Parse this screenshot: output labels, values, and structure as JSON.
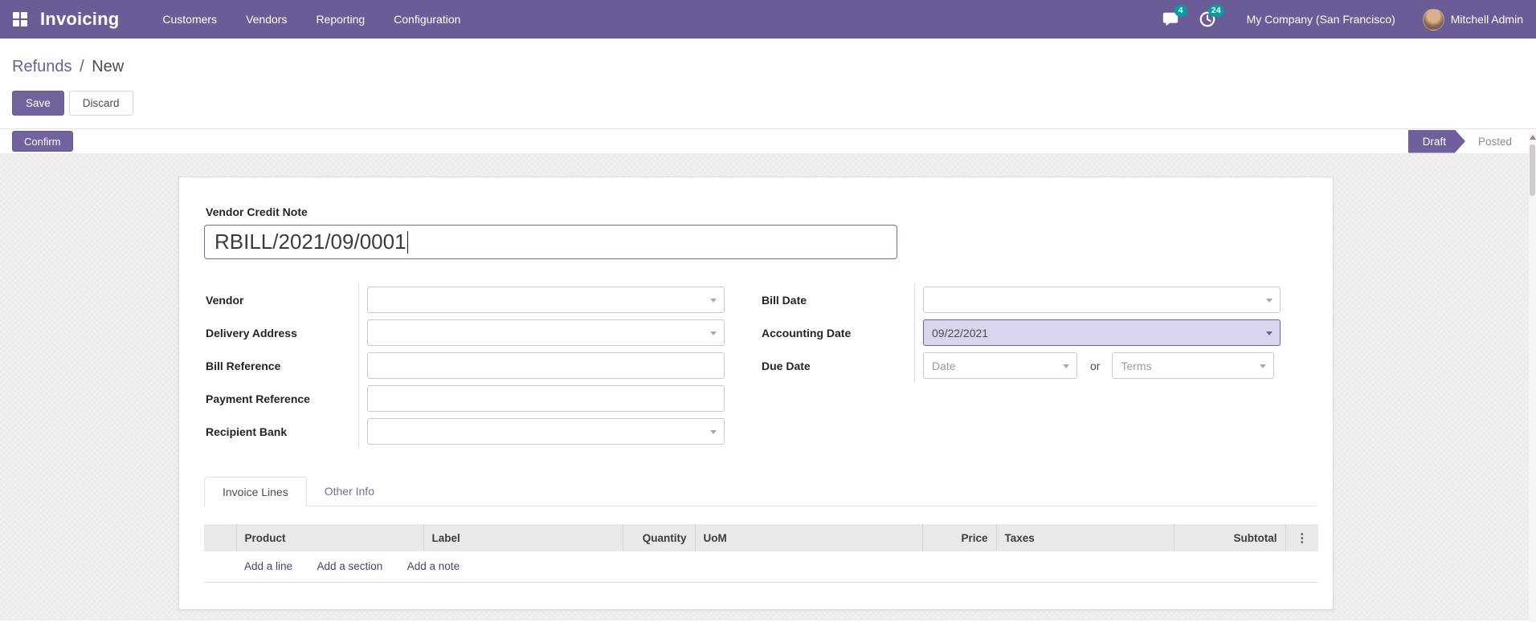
{
  "colors": {
    "brand_purple": "#6b5c98",
    "primary_button": "#72639f",
    "badge_teal": "#00a09d",
    "link_purple": "#6b5c95",
    "highlight_field_bg": "#d9d5ee"
  },
  "nav": {
    "app_name": "Invoicing",
    "menus": [
      {
        "label": "Customers"
      },
      {
        "label": "Vendors"
      },
      {
        "label": "Reporting"
      },
      {
        "label": "Configuration"
      }
    ],
    "messages_badge": "4",
    "activities_badge": "24",
    "company": "My Company (San Francisco)",
    "user": "Mitchell Admin"
  },
  "breadcrumb": {
    "parent": "Refunds",
    "separator": "/",
    "current": "New"
  },
  "control": {
    "save": "Save",
    "discard": "Discard"
  },
  "statusbar": {
    "confirm": "Confirm",
    "states": [
      {
        "label": "Draft",
        "active": true
      },
      {
        "label": "Posted",
        "active": false
      }
    ]
  },
  "form": {
    "title": {
      "label": "Vendor Credit Note",
      "value": "RBILL/2021/09/0001"
    },
    "fields": {
      "vendor": {
        "label": "Vendor",
        "value": "",
        "type": "dropdown"
      },
      "delivery_address": {
        "label": "Delivery Address",
        "value": "",
        "type": "dropdown"
      },
      "bill_reference": {
        "label": "Bill Reference",
        "value": "",
        "type": "text"
      },
      "payment_reference": {
        "label": "Payment Reference",
        "value": "",
        "type": "text"
      },
      "recipient_bank": {
        "label": "Recipient Bank",
        "value": "",
        "type": "dropdown"
      },
      "bill_date": {
        "label": "Bill Date",
        "value": "",
        "type": "date"
      },
      "accounting_date": {
        "label": "Accounting Date",
        "value": "09/22/2021",
        "highlighted": true
      },
      "due_date": {
        "label": "Due Date",
        "date_placeholder": "Date",
        "or": "or",
        "terms_placeholder": "Terms"
      }
    }
  },
  "tabs": [
    {
      "label": "Invoice Lines",
      "active": true
    },
    {
      "label": "Other Info",
      "active": false
    }
  ],
  "lines_table": {
    "columns": [
      {
        "label": ""
      },
      {
        "label": "Product"
      },
      {
        "label": "Label"
      },
      {
        "label": "Quantity"
      },
      {
        "label": "UoM"
      },
      {
        "label": "Price"
      },
      {
        "label": "Taxes"
      },
      {
        "label": "Subtotal"
      }
    ],
    "options_icon": "⋮",
    "add_links": [
      {
        "label": "Add a line"
      },
      {
        "label": "Add a section"
      },
      {
        "label": "Add a note"
      }
    ]
  }
}
